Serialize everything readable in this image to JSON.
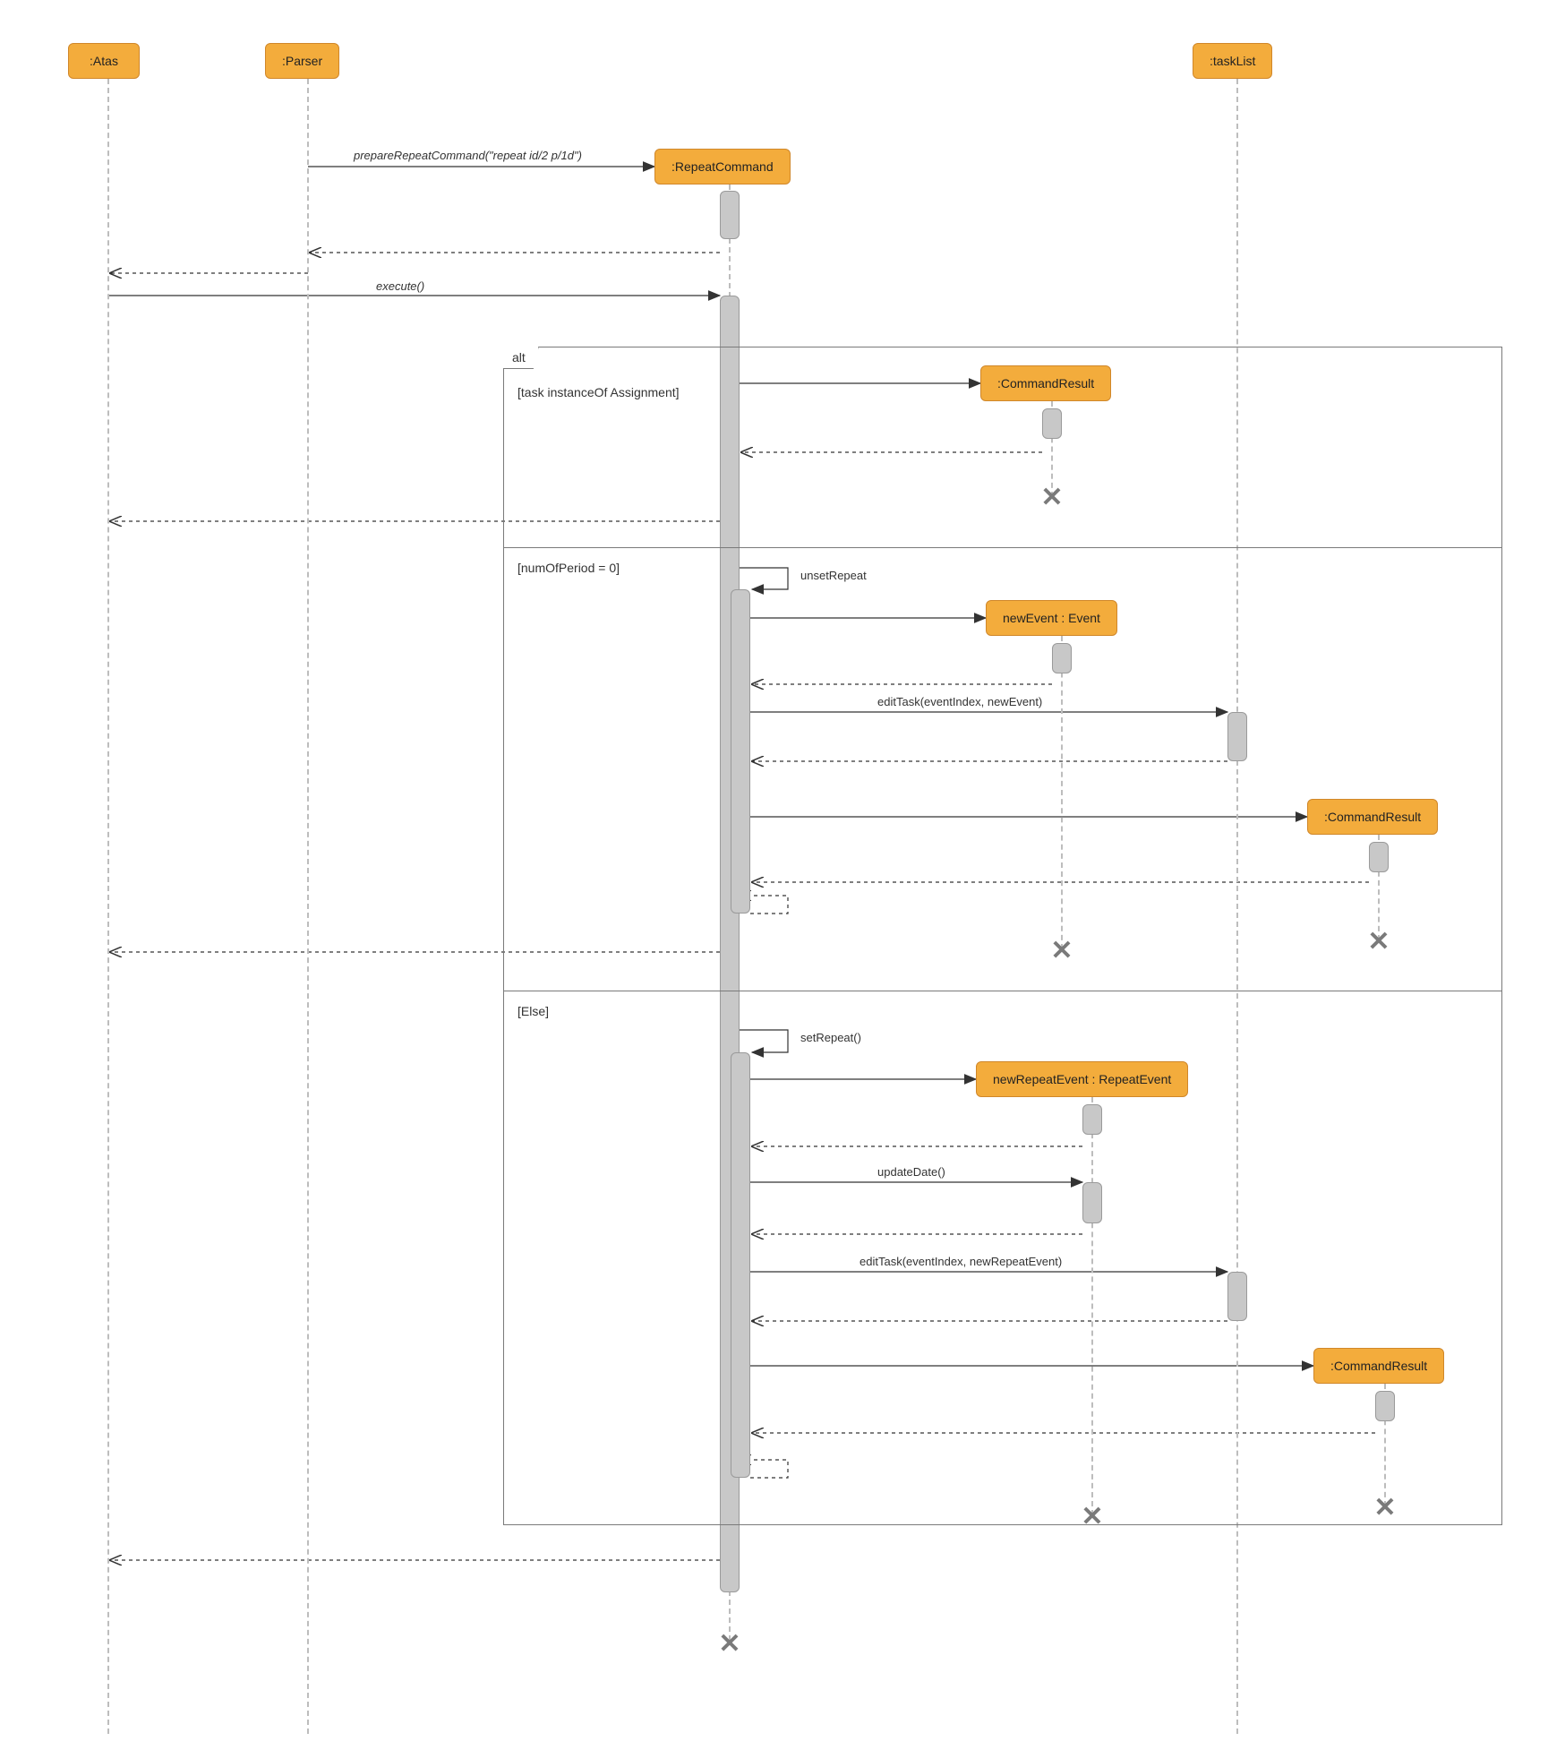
{
  "diagram": {
    "type": "UML Sequence Diagram",
    "lifelines": {
      "atas": ":Atas",
      "parser": ":Parser",
      "repeatCommand": ":RepeatCommand",
      "taskList": ":taskList",
      "commandResult1": ":CommandResult",
      "newEvent": "newEvent : Event",
      "commandResult2": ":CommandResult",
      "newRepeatEvent": "newRepeatEvent : RepeatEvent",
      "commandResult3": ":CommandResult"
    },
    "messages": {
      "prepare": "prepareRepeatCommand(\"repeat id/2 p/1d\")",
      "execute": "execute()",
      "unsetRepeat": "unsetRepeat",
      "editTask1": "editTask(eventIndex, newEvent)",
      "setRepeat": "setRepeat()",
      "updateDate": "updateDate()",
      "editTask2": "editTask(eventIndex, newRepeatEvent)"
    },
    "fragment": {
      "operator": "alt",
      "guard1": "[task instanceOf Assignment]",
      "guard2": "[numOfPeriod = 0]",
      "guard3": "[Else]"
    }
  },
  "layout": {
    "x": {
      "atas": 121,
      "parser": 344,
      "repeatCommand": 815,
      "commandResult1": 1175,
      "newEvent": 1186,
      "taskList": 1382,
      "commandResult2": 1540,
      "newRepeatEvent": 1220,
      "commandResult3": 1547
    },
    "headW": {
      "atas": 90,
      "parser": 96,
      "repeatCommand": 168,
      "commandResult1": 160,
      "newEvent": 170,
      "taskList": 100,
      "commandResult2": 160,
      "newRepeatEvent": 260,
      "commandResult3": 160
    }
  }
}
